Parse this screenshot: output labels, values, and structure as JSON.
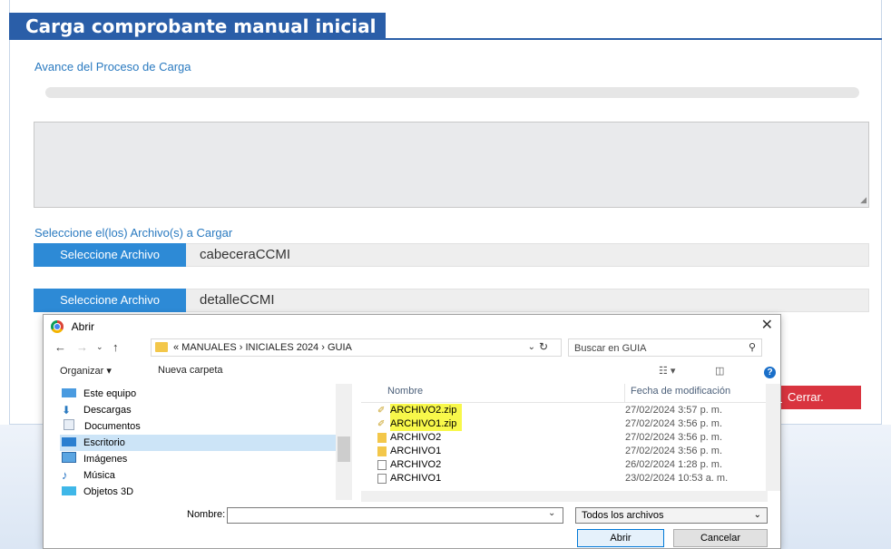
{
  "page": {
    "title": "Carga comprobante manual inicial",
    "progress_label": "Avance del Proceso de Carga",
    "progress_value": 0,
    "select_label": "Seleccione el(los) Archivo(s) a Cargar",
    "file_inputs": [
      {
        "button": "Seleccione Archivo",
        "filename": "cabeceraCCMI"
      },
      {
        "button": "Seleccione Archivo",
        "filename": "detalleCCMI"
      }
    ],
    "close_button": "Cerrar."
  },
  "dialog": {
    "title": "Abrir",
    "path": "« MANUALES › INICIALES 2024 › GUIA",
    "search_placeholder": "Buscar en GUIA",
    "organize": "Organizar ▾",
    "new_folder": "Nueva carpeta",
    "tree": [
      {
        "label": "Este equipo",
        "icon": "computer-icon"
      },
      {
        "label": "Descargas",
        "icon": "download-icon"
      },
      {
        "label": "Documentos",
        "icon": "documents-icon"
      },
      {
        "label": "Escritorio",
        "icon": "desktop-icon",
        "selected": true
      },
      {
        "label": "Imágenes",
        "icon": "images-icon"
      },
      {
        "label": "Música",
        "icon": "music-icon"
      },
      {
        "label": "Objetos 3D",
        "icon": "objects3d-icon"
      }
    ],
    "columns": {
      "name": "Nombre",
      "date": "Fecha de modificación"
    },
    "files": [
      {
        "name": "ARCHIVO2.zip",
        "date": "27/02/2024 3:57 p. m.",
        "type": "zip",
        "highlight": true
      },
      {
        "name": "ARCHIVO1.zip",
        "date": "27/02/2024 3:56 p. m.",
        "type": "zip",
        "highlight": true
      },
      {
        "name": "ARCHIVO2",
        "date": "27/02/2024 3:56 p. m.",
        "type": "zipfolder"
      },
      {
        "name": "ARCHIVO1",
        "date": "27/02/2024 3:56 p. m.",
        "type": "zipfolder"
      },
      {
        "name": "ARCHIVO2",
        "date": "26/02/2024 1:28 p. m.",
        "type": "text"
      },
      {
        "name": "ARCHIVO1",
        "date": "23/02/2024 10:53 a. m.",
        "type": "text"
      }
    ],
    "name_label": "Nombre:",
    "name_value": "",
    "filter": "Todos los archivos",
    "open_button": "Abrir",
    "cancel_button": "Cancelar"
  },
  "colors": {
    "brand": "#2a5ea8",
    "button": "#2d8ad6",
    "close": "#d9343f",
    "highlight": "#f8f84a"
  }
}
